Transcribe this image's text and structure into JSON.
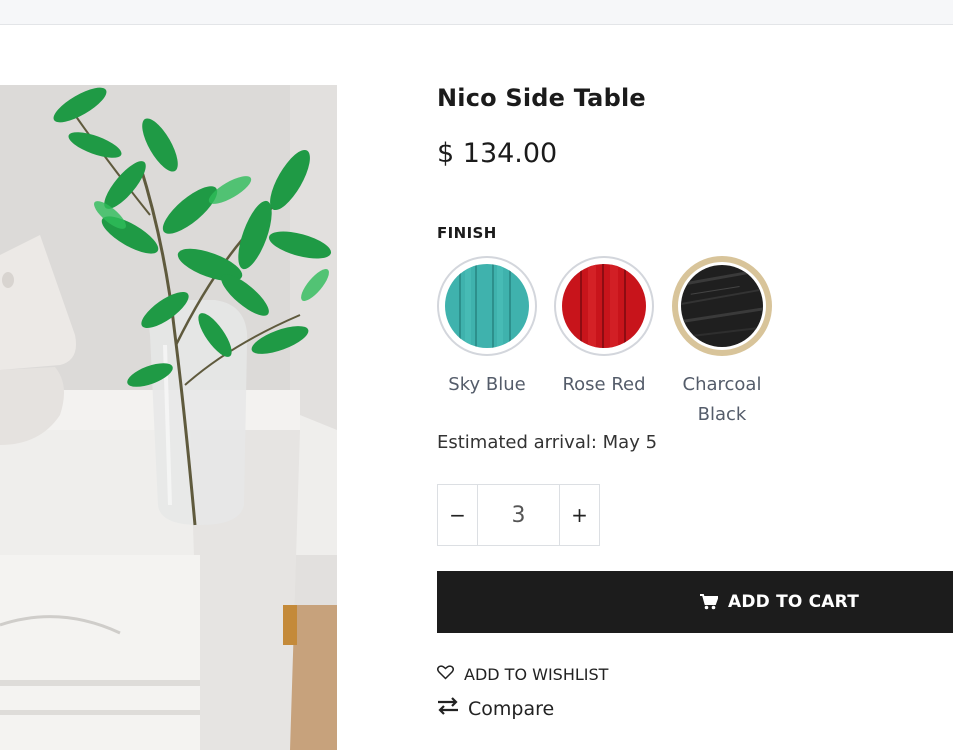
{
  "product": {
    "title": "Nico Side Table",
    "price": "$ 134.00"
  },
  "finish": {
    "label": "FINISH",
    "options": [
      {
        "name": "Sky Blue",
        "color": "#3fb2ad",
        "selected": false
      },
      {
        "name": "Rose Red",
        "color": "#c8141b",
        "selected": false
      },
      {
        "name": "Charcoal Black",
        "color": "#1f1f1f",
        "selected": true
      }
    ],
    "selected_ring_color": "#d8c49a"
  },
  "shipping": {
    "arrival": "Estimated arrival: May 5"
  },
  "quantity": {
    "value": "3",
    "decrement_symbol": "−",
    "increment_symbol": "+"
  },
  "actions": {
    "add_to_cart": "ADD TO CART",
    "add_to_wishlist": "ADD TO WISHLIST",
    "compare": "Compare"
  },
  "icons": {
    "cart": "cart-icon",
    "wishlist": "heart-icon",
    "compare": "compare-arrows-icon"
  }
}
